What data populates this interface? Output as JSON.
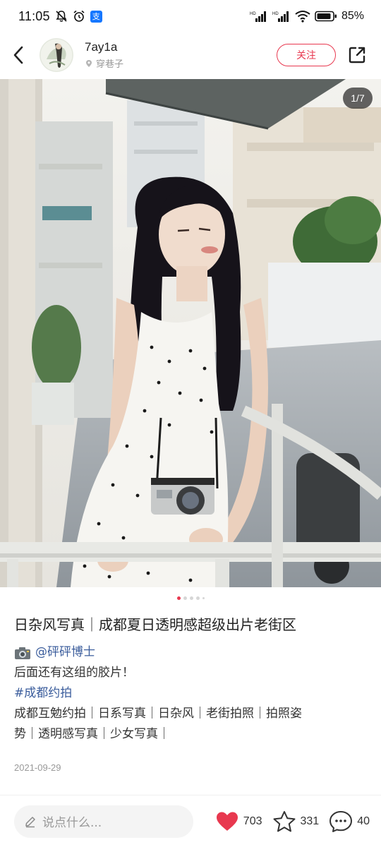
{
  "status_bar": {
    "time": "11:05",
    "alipay_label": "支",
    "battery": "85%"
  },
  "header": {
    "author_name": "7ay1a",
    "author_location": "穿巷子",
    "follow_label": "关注"
  },
  "photo": {
    "page_indicator": "1/7",
    "total": 7,
    "current": 1
  },
  "post": {
    "title": "日杂风写真｜成都夏日透明感超级出片老街区",
    "mention": "@砰砰博士",
    "line2": "后面还有这组的胶片！",
    "hashtag": "#成都约拍",
    "tags_line1": "成都互勉约拍｜日系写真｜日杂风｜老街拍照｜拍照姿",
    "tags_line2": "势｜透明感写真｜少女写真｜",
    "date": "2021-09-29"
  },
  "bottom_bar": {
    "comment_placeholder": "说点什么...",
    "likes": "703",
    "collects": "331",
    "comments": "40"
  },
  "colors": {
    "accent": "#e8384f",
    "link": "#3b5d9c"
  }
}
